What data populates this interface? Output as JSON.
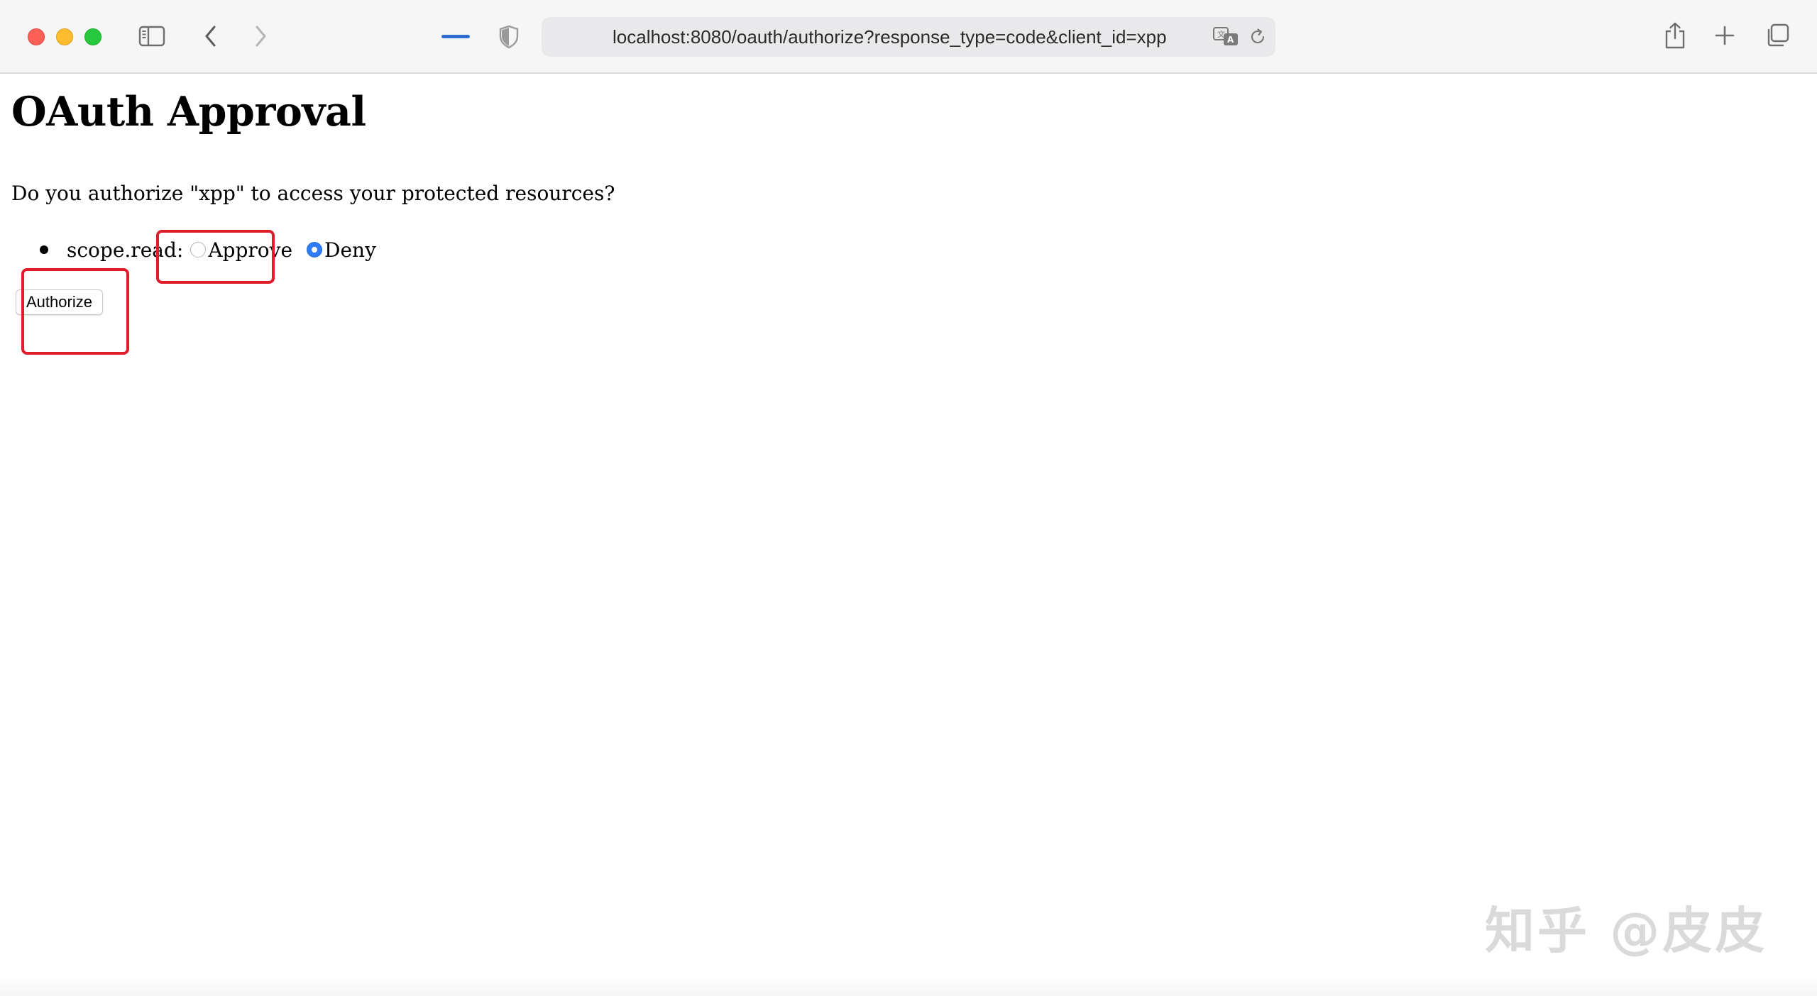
{
  "browser": {
    "url": "localhost:8080/oauth/authorize?response_type=code&client_id=xpp",
    "icons": {
      "close": "close-window-icon",
      "minimize": "minimize-window-icon",
      "maximize": "maximize-window-icon",
      "sidebar": "sidebar-icon",
      "back": "chevron-left-icon",
      "forward": "chevron-right-icon",
      "privacy": "shield-icon",
      "translate": "translate-icon",
      "reload": "reload-icon",
      "share": "share-icon",
      "new_tab": "plus-icon",
      "tabs_overview": "tabs-overview-icon"
    }
  },
  "page": {
    "title": "OAuth Approval",
    "question": "Do you authorize \"xpp\" to access your protected resources?",
    "scope": {
      "label": "scope.read:",
      "options": [
        {
          "label": "Approve",
          "selected": false
        },
        {
          "label": "Deny",
          "selected": true
        }
      ]
    },
    "authorize_button": "Authorize"
  },
  "watermark": "知乎 @皮皮",
  "colors": {
    "annotation": "#e01d2b",
    "radio_selected": "#2f7cf6",
    "tab_indicator": "#2f6fd1"
  }
}
